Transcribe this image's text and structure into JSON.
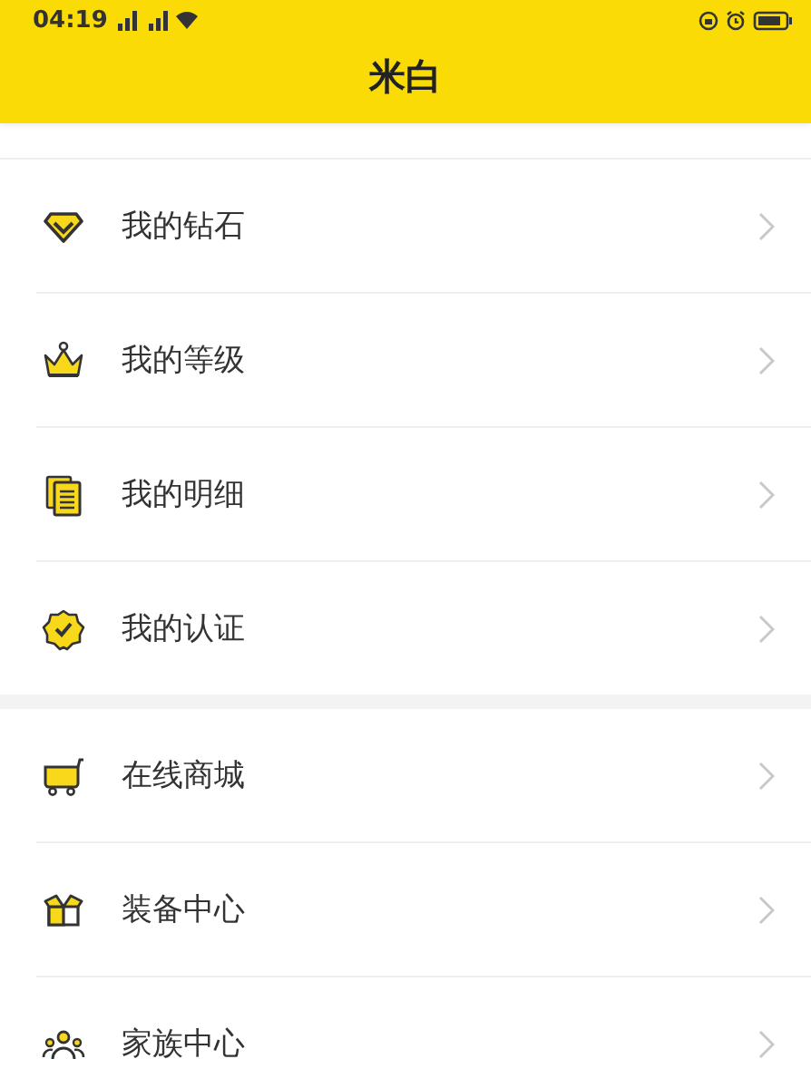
{
  "status_bar": {
    "time": "04:19"
  },
  "header": {
    "title": "米白"
  },
  "sections": [
    {
      "items": [
        {
          "label": "我的钻石"
        },
        {
          "label": "我的等级"
        },
        {
          "label": "我的明细"
        },
        {
          "label": "我的认证"
        }
      ]
    },
    {
      "items": [
        {
          "label": "在线商城"
        },
        {
          "label": "装备中心"
        },
        {
          "label": "家族中心"
        }
      ]
    }
  ]
}
